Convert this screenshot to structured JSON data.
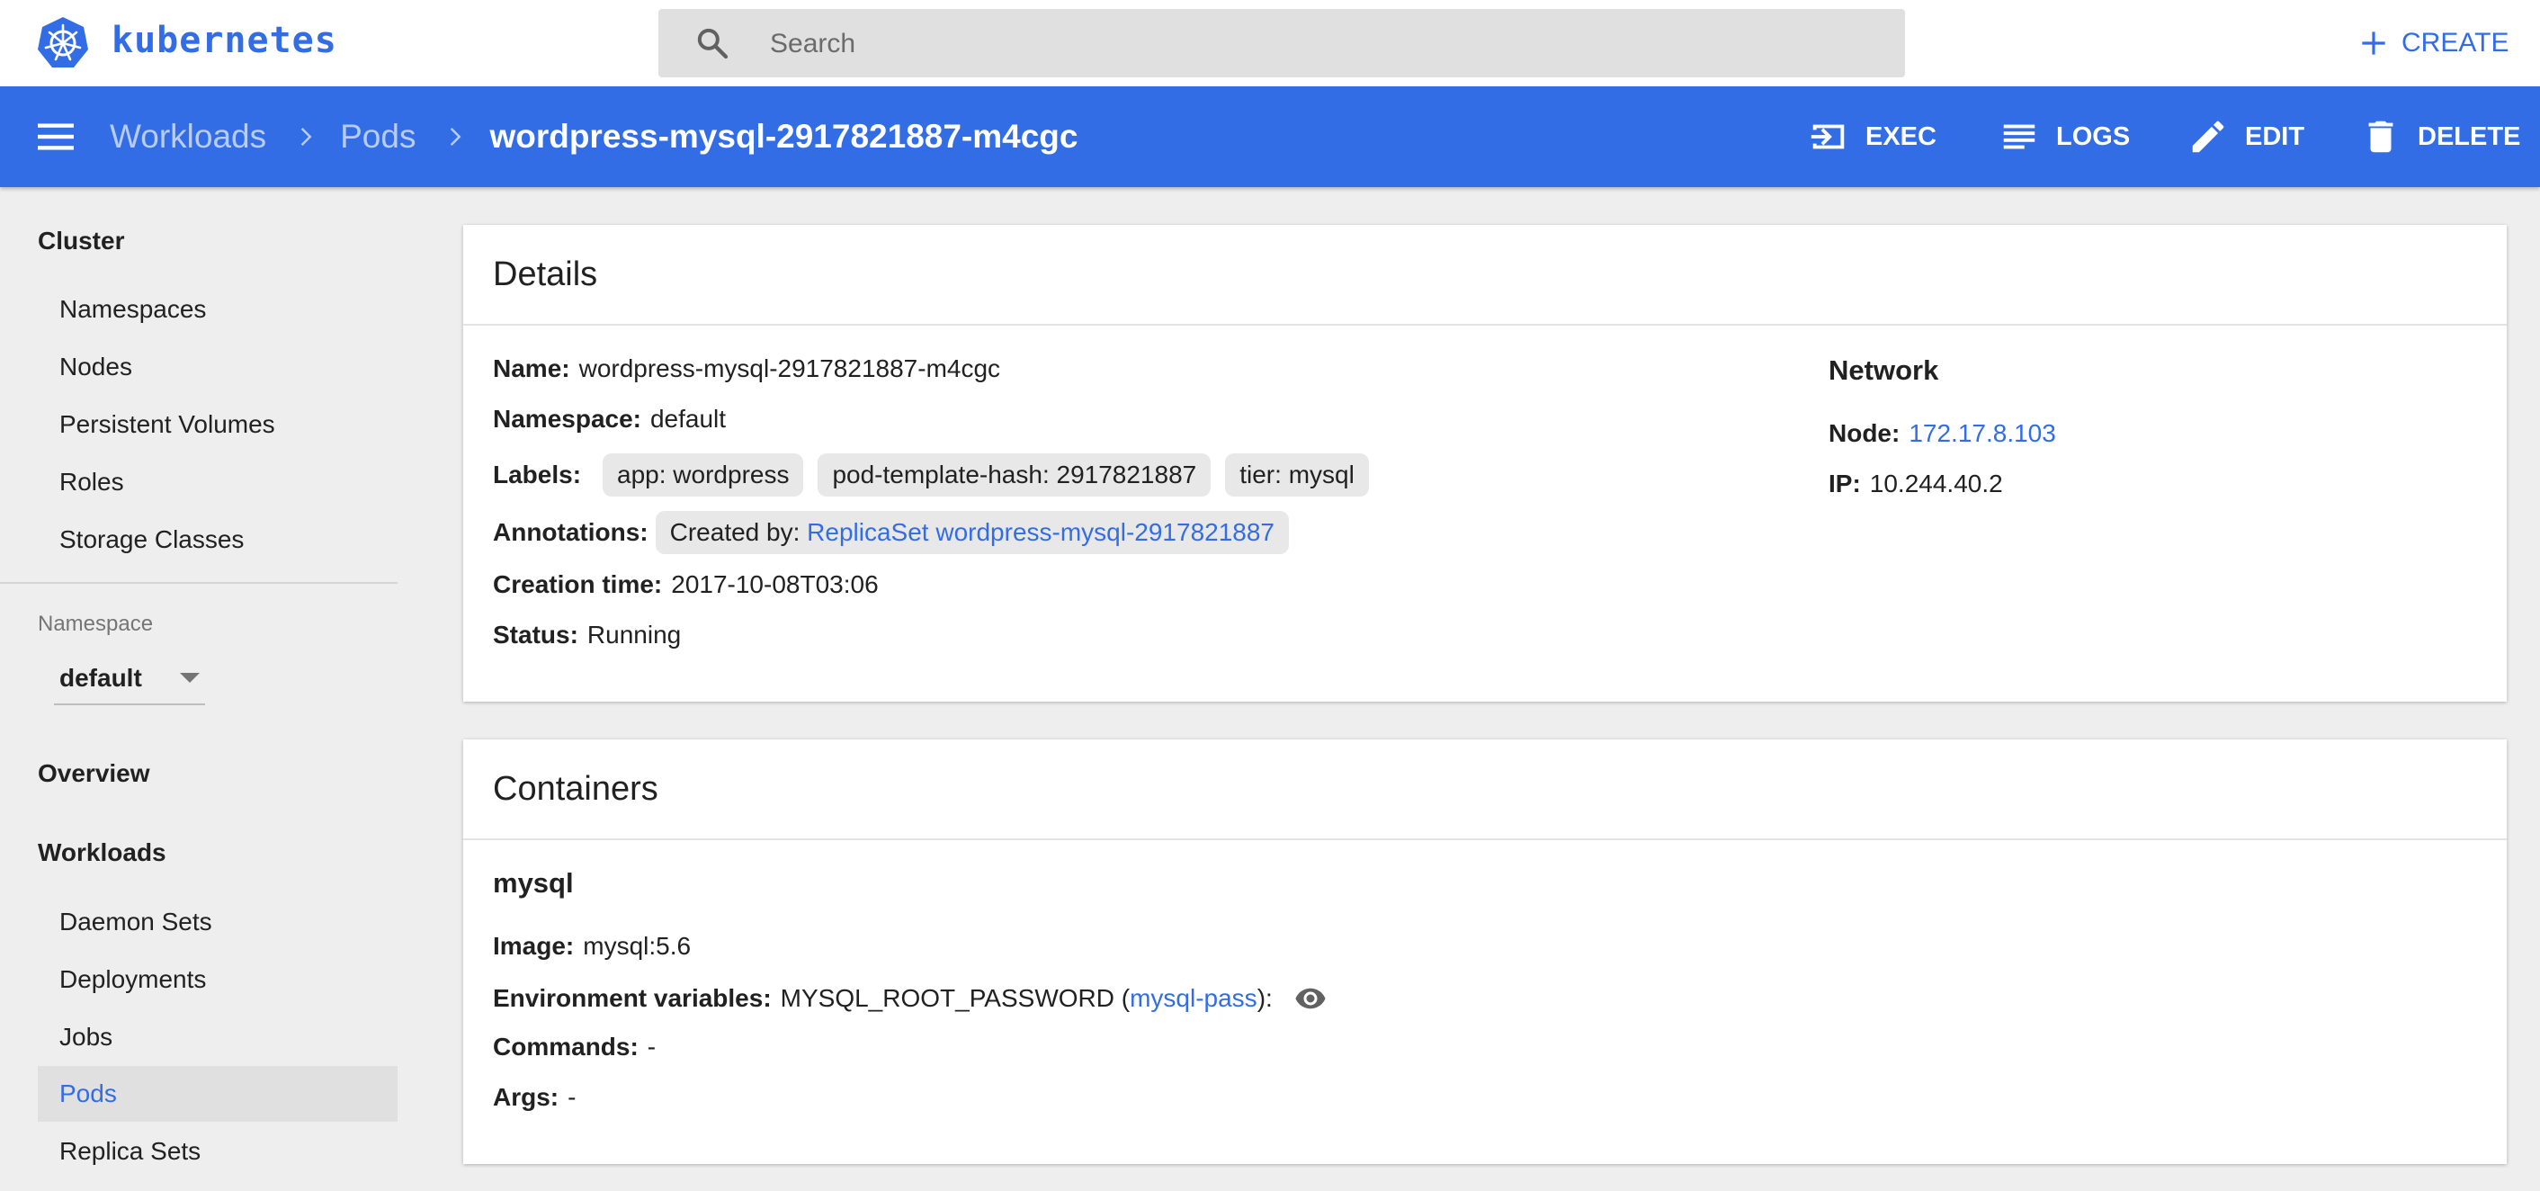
{
  "app": {
    "brand": "kubernetes",
    "search_placeholder": "Search",
    "create_label": "CREATE"
  },
  "toolbar": {
    "breadcrumbs": [
      "Workloads",
      "Pods"
    ],
    "current": "wordpress-mysql-2917821887-m4cgc",
    "actions": {
      "exec": "EXEC",
      "logs": "LOGS",
      "edit": "EDIT",
      "delete": "DELETE"
    }
  },
  "sidebar": {
    "cluster_heading": "Cluster",
    "cluster_items": [
      "Namespaces",
      "Nodes",
      "Persistent Volumes",
      "Roles",
      "Storage Classes"
    ],
    "namespace_label": "Namespace",
    "namespace_value": "default",
    "overview": "Overview",
    "workloads_heading": "Workloads",
    "workload_items": [
      "Daemon Sets",
      "Deployments",
      "Jobs",
      "Pods",
      "Replica Sets"
    ],
    "active_item": "Pods"
  },
  "details": {
    "title": "Details",
    "name_key": "Name:",
    "name": "wordpress-mysql-2917821887-m4cgc",
    "namespace_key": "Namespace:",
    "namespace": "default",
    "labels_key": "Labels:",
    "labels": [
      "app: wordpress",
      "pod-template-hash: 2917821887",
      "tier: mysql"
    ],
    "annotations_key": "Annotations:",
    "annotation_prefix": "Created by:",
    "annotation_link": "ReplicaSet wordpress-mysql-2917821887",
    "creation_key": "Creation time:",
    "creation_time": "2017-10-08T03:06",
    "status_key": "Status:",
    "status": "Running",
    "network": {
      "heading": "Network",
      "node_key": "Node:",
      "node": "172.17.8.103",
      "ip_key": "IP:",
      "ip": "10.244.40.2"
    }
  },
  "containers": {
    "title": "Containers",
    "name": "mysql",
    "image_key": "Image:",
    "image": "mysql:5.6",
    "env_key": "Environment variables:",
    "env_name": "MYSQL_ROOT_PASSWORD (",
    "env_link": "mysql-pass",
    "env_suffix": "):",
    "commands_key": "Commands:",
    "commands": "-",
    "args_key": "Args:",
    "args": "-"
  },
  "colors": {
    "accent": "#326de6",
    "background": "#eeeeee"
  }
}
